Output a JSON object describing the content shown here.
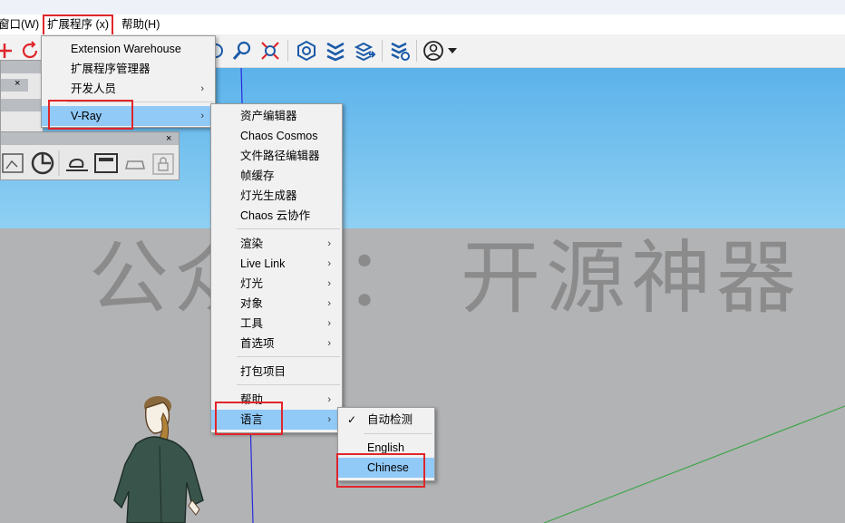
{
  "menubar": {
    "items": [
      "窗口(W)",
      "扩展程序 (x)",
      "帮助(H)"
    ]
  },
  "extensions_menu": {
    "items": [
      {
        "label": "Extension Warehouse",
        "submenu": false
      },
      {
        "label": "扩展程序管理器",
        "submenu": false
      },
      {
        "label": "开发人员",
        "submenu": true
      },
      {
        "label": "V-Ray",
        "submenu": true,
        "highlighted": true
      }
    ]
  },
  "vray_menu": {
    "group1": [
      "资产编辑器",
      "Chaos Cosmos",
      "文件路径编辑器",
      "帧缓存",
      "灯光生成器",
      "Chaos 云协作"
    ],
    "group2": [
      "渲染",
      "Live Link",
      "灯光",
      "对象",
      "工具",
      "首选项"
    ],
    "group3": [
      "打包项目"
    ],
    "group4": [
      "帮助",
      "语言"
    ],
    "highlighted": "语言"
  },
  "language_menu": {
    "items": [
      {
        "label": "自动检测",
        "checked": true
      },
      {
        "label": "English",
        "checked": false
      },
      {
        "label": "Chinese",
        "checked": false,
        "highlighted": true
      }
    ],
    "check_glyph": "✓"
  },
  "watermark": "公众号： 开源神器",
  "panels": {
    "close_glyph": "×"
  },
  "colors": {
    "highlight": "#91c9f7",
    "annotation_red": "#e0262b",
    "toolbar_blue": "#1a5aa8",
    "sky": "#6cbcec",
    "ground": "#b2b3b5",
    "axis_green": "#3fa64a",
    "axis_blue": "#2a2ae0"
  }
}
